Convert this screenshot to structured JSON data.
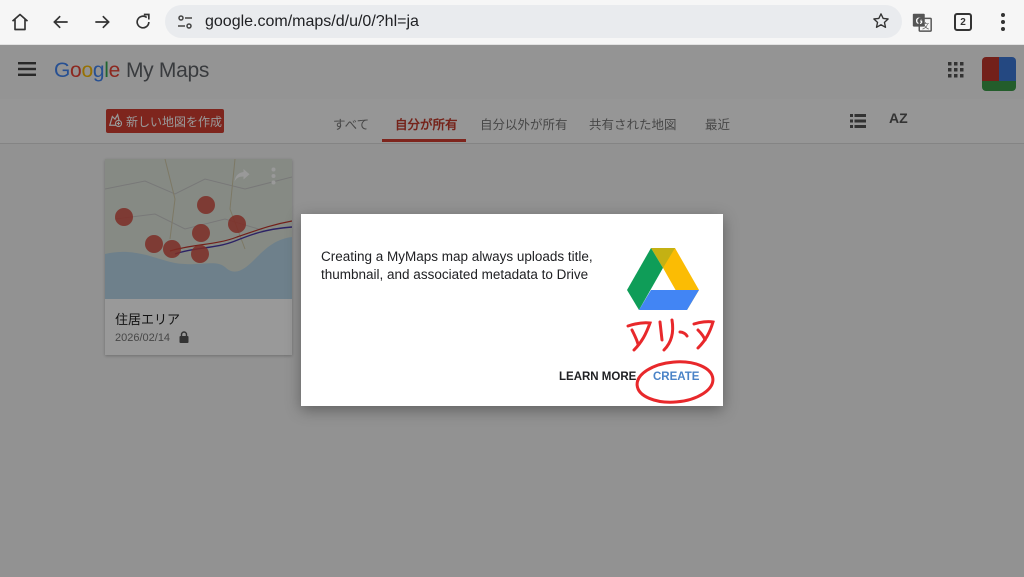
{
  "browser": {
    "url": "google.com/maps/d/u/0/?hl=ja",
    "tab_count": "2"
  },
  "app": {
    "logo_google": [
      "G",
      "o",
      "o",
      "g",
      "l",
      "e"
    ],
    "logo_product": "My Maps"
  },
  "toolbar": {
    "new_map_label": "新しい地図を作成",
    "tabs": [
      {
        "label": "すべて"
      },
      {
        "label": "自分が所有"
      },
      {
        "label": "自分以外が所有"
      },
      {
        "label": "共有された地図"
      },
      {
        "label": "最近"
      }
    ],
    "active_tab": "自分が所有",
    "sort_label": "AZ"
  },
  "maps": [
    {
      "title": "住居エリア",
      "date": "2026/02/14",
      "private": true
    }
  ],
  "dialog": {
    "message": "Creating a MyMaps map always uploads title, thumbnail, and associated metadata to Drive",
    "learn_more": "LEARN MORE",
    "create": "CREATE",
    "annotation": "クリック"
  },
  "colors": {
    "brand_red": "#d23f31",
    "create_blue": "#4a83c7",
    "annotation_red": "#e8282b"
  }
}
